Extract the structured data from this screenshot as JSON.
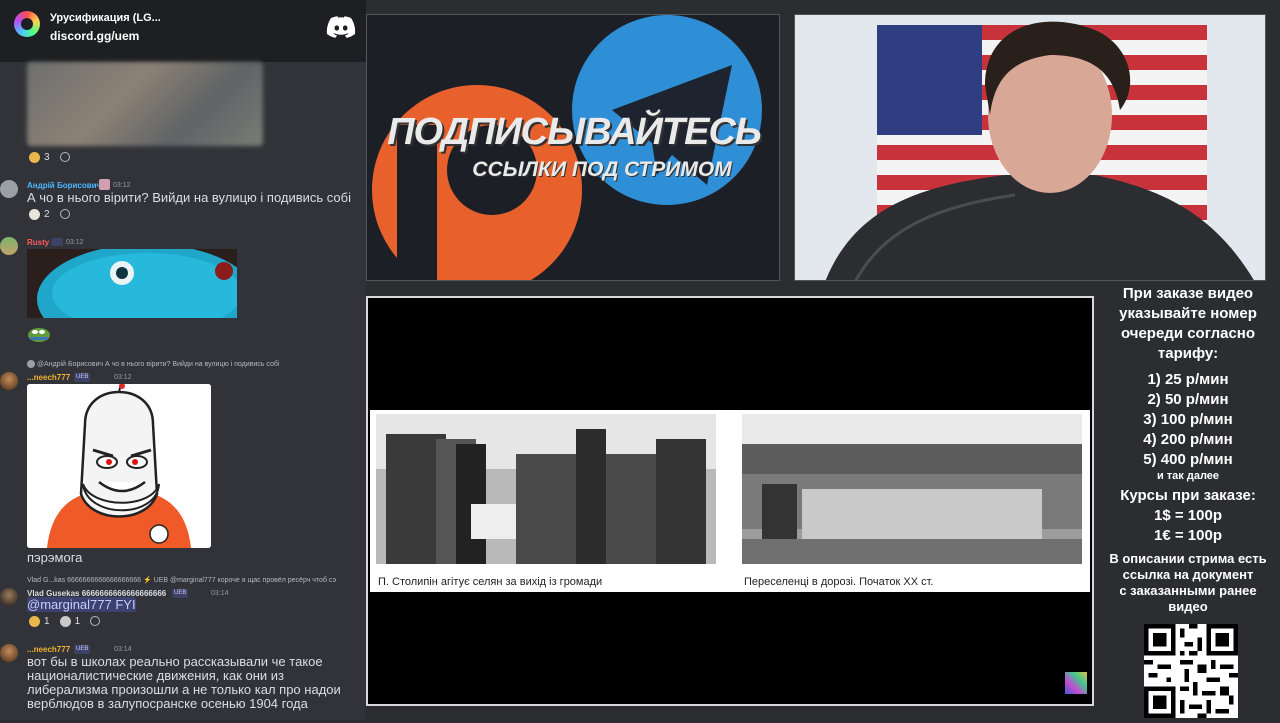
{
  "server": {
    "name": "Урусификация (LG...",
    "link": "discord.gg/uem"
  },
  "messages": [
    {
      "reactions": [
        {
          "emoji": "smile",
          "count": "3"
        }
      ]
    },
    {
      "user": "Андрій Борисович",
      "time": "03:12",
      "text": "А чо в нього вірити? Вийди на вулицю і подивись собі",
      "reactions": [
        {
          "emoji": "egg",
          "count": "2"
        }
      ]
    },
    {
      "user": "Rusty",
      "time": "03:12"
    },
    {
      "reply": "@Андрій Борисович А чо в нього вірити? Вийди на вулицю і подивись собі",
      "user": "...neech777",
      "badge": "UEB",
      "time": "03:12",
      "text": "пэрэмога"
    },
    {
      "reply": "Vlad G...kas 6666666666666666666 ⚡ UEB @marginal777 короче я щас провёл ресёрч чтоб сэ",
      "user": "Vlad Gusekas 6666666666666666666",
      "badge": "UEB",
      "time": "03:14",
      "text": "@marginal777 FYI",
      "reactions": [
        {
          "emoji": "smile",
          "count": "1"
        },
        {
          "emoji": "rocket",
          "count": "1"
        }
      ]
    },
    {
      "user": "...neech777",
      "badge": "UEB",
      "time": "03:14",
      "text": "вот бы в школах реально рассказывали че такое националистические движения, как они из либерализма произошли а не только кал про надои верблюдов в залупосранске осенью 1904 года"
    }
  ],
  "promo": {
    "line1": "ПОДПИСЫВАЙТЕСЬ",
    "line2": "ССЫЛКИ ПОД СТРИМОМ"
  },
  "slide": {
    "caption_left": "П. Столипін агітує селян за вихід із громади",
    "caption_right": "Переселенці в дорозі. Початок ХХ ст."
  },
  "info": {
    "heading": [
      "При заказе видео",
      "указывайте номер",
      "очереди согласно",
      "тарифу:"
    ],
    "tariffs": [
      "1) 25 р/мин",
      "2) 50 р/мин",
      "3) 100 р/мин",
      "4) 200 р/мин",
      "5) 400 р/мин"
    ],
    "etc": "и так далее",
    "courses_title": "Курсы при заказе:",
    "courses": [
      "1$ = 100р",
      "1€ = 100р"
    ],
    "note": [
      "В описании стрима есть",
      "ссылка на документ",
      "с заказанными ранее",
      "видео"
    ]
  },
  "colors": {
    "discord_bg": "#313338",
    "server_bar": "#1e1f22",
    "telegram_blue": "#2f8fd6",
    "patreon_orange": "#e8612c"
  }
}
